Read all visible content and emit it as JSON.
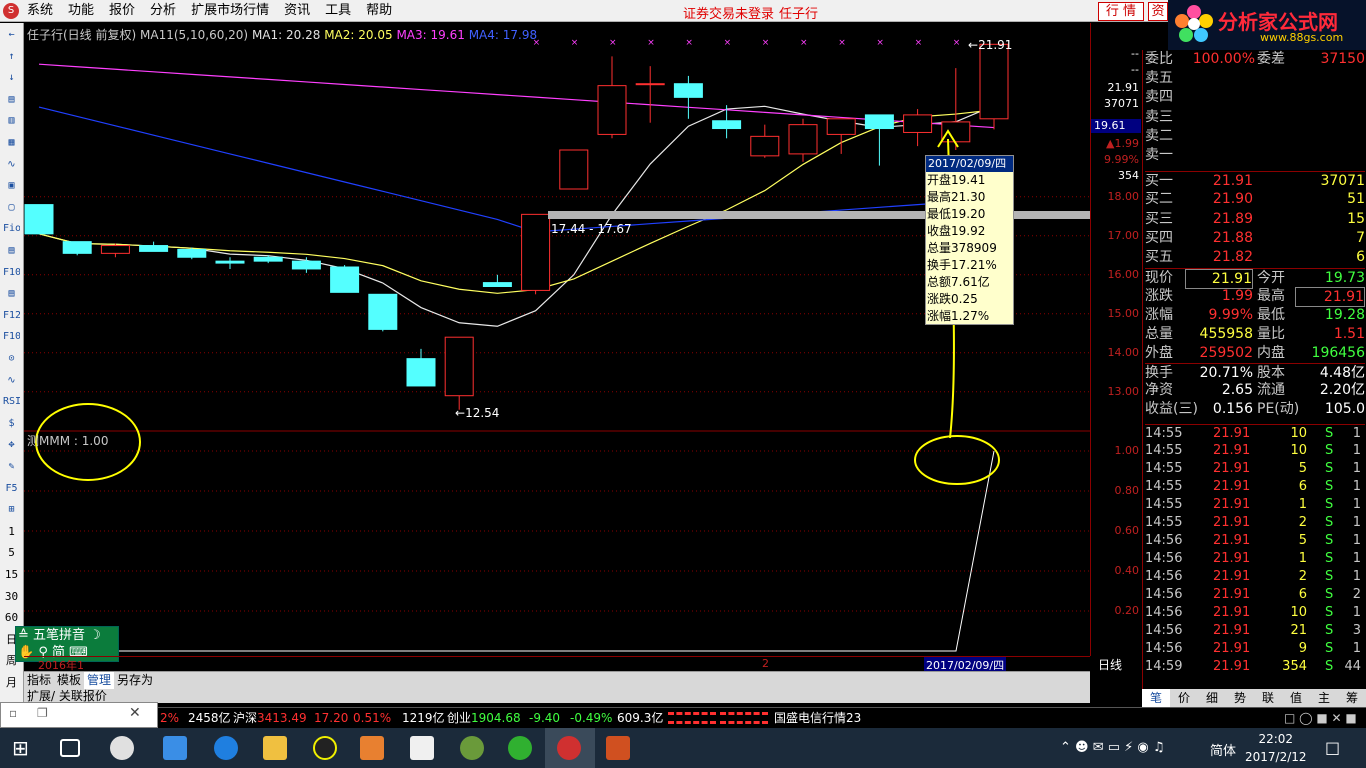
{
  "menu": {
    "items": [
      "系统",
      "功能",
      "报价",
      "分析",
      "扩展市场行情",
      "资讯",
      "工具",
      "帮助"
    ],
    "status": "证券交易未登录",
    "stock_name": "任子行",
    "quote_btn": "行 情",
    "trade_btn": "资"
  },
  "ad": {
    "title": "分析家公式网",
    "url": "www.88gs.com"
  },
  "left_toolbar": [
    "←",
    "↑",
    "↓",
    "▤",
    "▥",
    "▦",
    "∿",
    "▣",
    "▢",
    "Fio",
    "▤",
    "F10",
    "▤",
    "F12",
    "F10",
    "⊙",
    "∿",
    "RSI",
    "$",
    "✥",
    "✎",
    "F5",
    "⊞",
    "1",
    "5",
    "15",
    "30",
    "60",
    "日",
    "周",
    "月"
  ],
  "price_title": {
    "stock": "任子行(日线 前复权)",
    "formula": "MA11(5,10,60,20)",
    "ma1_label": "MA1: 20.28",
    "ma2_label": "MA2: 20.05",
    "ma3_label": "MA3: 19.61",
    "ma4_label": "MA4: 17.98"
  },
  "indicator_title": "测MMM : 1.00",
  "high_label": "21.91",
  "low_label": "12.54",
  "range_label": "17.44 - 17.67",
  "tooltip": {
    "date": "2017/02/09/四",
    "rows": [
      {
        "k": "开盘",
        "v": "19.41"
      },
      {
        "k": "最高",
        "v": "21.30"
      },
      {
        "k": "最低",
        "v": "19.20"
      },
      {
        "k": "收盘",
        "v": "19.92"
      },
      {
        "k": "总量",
        "v": "378909"
      },
      {
        "k": "换手",
        "v": "17.21%"
      },
      {
        "k": "总额",
        "v": "7.61亿"
      },
      {
        "k": "涨跌",
        "v": "0.25"
      },
      {
        "k": "涨幅",
        "v": "1.27%"
      }
    ]
  },
  "right_scale": {
    "top": [
      "--",
      "--",
      "21.91",
      "37071"
    ],
    "ma_badge": "19.61",
    "change": "▲1.99",
    "pct": "9.99%",
    "vol": "354",
    "ticks": [
      "18.00",
      "17.00",
      "16.00",
      "15.00",
      "14.00",
      "13.00"
    ],
    "ind_ticks": [
      "1.00",
      "0.80",
      "0.60",
      "0.40",
      "0.20"
    ]
  },
  "order_book": {
    "weibi_label": "委比",
    "weibi": "100.00%",
    "weicha_label": "委差",
    "weicha": "37150",
    "sells": [
      {
        "k": "卖五",
        "p": "",
        "v": ""
      },
      {
        "k": "卖四",
        "p": "",
        "v": ""
      },
      {
        "k": "卖三",
        "p": "",
        "v": ""
      },
      {
        "k": "卖二",
        "p": "",
        "v": ""
      },
      {
        "k": "卖一",
        "p": "",
        "v": ""
      }
    ],
    "buys": [
      {
        "k": "买一",
        "p": "21.91",
        "v": "37071"
      },
      {
        "k": "买二",
        "p": "21.90",
        "v": "51"
      },
      {
        "k": "买三",
        "p": "21.89",
        "v": "15"
      },
      {
        "k": "买四",
        "p": "21.88",
        "v": "7"
      },
      {
        "k": "买五",
        "p": "21.82",
        "v": "6"
      }
    ]
  },
  "quote": [
    {
      "k1": "现价",
      "v1": "21.91",
      "k2": "今开",
      "v2": "19.73"
    },
    {
      "k1": "涨跌",
      "v1": "1.99",
      "k2": "最高",
      "v2": "21.91"
    },
    {
      "k1": "涨幅",
      "v1": "9.99%",
      "k2": "最低",
      "v2": "19.28"
    },
    {
      "k1": "总量",
      "v1": "455958",
      "k2": "量比",
      "v2": "1.51"
    },
    {
      "k1": "外盘",
      "v1": "259502",
      "k2": "内盘",
      "v2": "196456"
    },
    {
      "k1": "换手",
      "v1": "20.71%",
      "k2": "股本",
      "v2": "4.48亿"
    },
    {
      "k1": "净资",
      "v1": "2.65",
      "k2": "流通",
      "v2": "2.20亿"
    },
    {
      "k1": "收益(三)",
      "v1": "0.156",
      "k2": "PE(动)",
      "v2": "105.0"
    }
  ],
  "ticks": [
    {
      "t": "14:55",
      "p": "21.91",
      "v": "10",
      "s": "S",
      "n": "1"
    },
    {
      "t": "14:55",
      "p": "21.91",
      "v": "10",
      "s": "S",
      "n": "1"
    },
    {
      "t": "14:55",
      "p": "21.91",
      "v": "5",
      "s": "S",
      "n": "1"
    },
    {
      "t": "14:55",
      "p": "21.91",
      "v": "6",
      "s": "S",
      "n": "1"
    },
    {
      "t": "14:55",
      "p": "21.91",
      "v": "1",
      "s": "S",
      "n": "1"
    },
    {
      "t": "14:55",
      "p": "21.91",
      "v": "2",
      "s": "S",
      "n": "1"
    },
    {
      "t": "14:56",
      "p": "21.91",
      "v": "5",
      "s": "S",
      "n": "1"
    },
    {
      "t": "14:56",
      "p": "21.91",
      "v": "1",
      "s": "S",
      "n": "1"
    },
    {
      "t": "14:56",
      "p": "21.91",
      "v": "2",
      "s": "S",
      "n": "1"
    },
    {
      "t": "14:56",
      "p": "21.91",
      "v": "6",
      "s": "S",
      "n": "2"
    },
    {
      "t": "14:56",
      "p": "21.91",
      "v": "10",
      "s": "S",
      "n": "1"
    },
    {
      "t": "14:56",
      "p": "21.91",
      "v": "21",
      "s": "S",
      "n": "3"
    },
    {
      "t": "14:56",
      "p": "21.91",
      "v": "9",
      "s": "S",
      "n": "1"
    },
    {
      "t": "14:59",
      "p": "21.91",
      "v": "354",
      "s": "S",
      "n": "44"
    }
  ],
  "ime": {
    "name": "五笔拼音",
    "mode": "简"
  },
  "bottom_tabs": [
    "指标",
    "模板",
    "管理",
    "另存为"
  ],
  "ext_bar": "扩展/  关联报价",
  "date_bar": {
    "left": "2016年1",
    "mid": "2",
    "cursor": "2017/02/09/四",
    "period": "日线"
  },
  "rp_tabs": [
    "笔",
    "价",
    "细",
    "势",
    "联",
    "值",
    "主",
    "筹"
  ],
  "statusbar": {
    "a": "2%",
    "b": "2458亿",
    "hs_label": "沪深",
    "hs_val": "3413.49",
    "hs_chg": "17.20",
    "hs_pct": "0.51%",
    "hs_amt": "1219亿",
    "cy_label": "创业",
    "cy_val": "1904.68",
    "cy_chg": "-9.40",
    "cy_pct": "-0.49%",
    "cy_amt": "609.3亿",
    "news": "国盛电信行情23"
  },
  "clock": {
    "time": "22:02",
    "date": "2017/2/12",
    "ime": "简体"
  },
  "chart_data": {
    "type": "candlestick",
    "series": [
      {
        "o": 17.8,
        "h": 17.8,
        "c": 17.05,
        "l": 17.05
      },
      {
        "o": 16.85,
        "h": 16.85,
        "c": 16.55,
        "l": 16.5
      },
      {
        "o": 16.55,
        "h": 16.8,
        "c": 16.75,
        "l": 16.45
      },
      {
        "o": 16.75,
        "h": 16.85,
        "c": 16.6,
        "l": 16.6
      },
      {
        "o": 16.65,
        "h": 16.7,
        "c": 16.45,
        "l": 16.4
      },
      {
        "o": 16.35,
        "h": 16.45,
        "c": 16.3,
        "l": 16.15
      },
      {
        "o": 16.45,
        "h": 16.5,
        "c": 16.35,
        "l": 16.3
      },
      {
        "o": 16.35,
        "h": 16.45,
        "c": 16.15,
        "l": 16.05
      },
      {
        "o": 16.2,
        "h": 16.25,
        "c": 15.55,
        "l": 15.55
      },
      {
        "o": 15.5,
        "h": 15.5,
        "c": 14.6,
        "l": 14.55
      },
      {
        "o": 13.85,
        "h": 14.1,
        "c": 13.15,
        "l": 13.15
      },
      {
        "o": 12.9,
        "h": 14.4,
        "c": 14.4,
        "l": 12.54
      },
      {
        "o": 15.8,
        "h": 16.0,
        "c": 15.7,
        "l": 15.7
      },
      {
        "o": 15.6,
        "h": 17.55,
        "c": 17.55,
        "l": 15.5
      },
      {
        "o": 18.2,
        "h": 19.2,
        "c": 19.2,
        "l": 18.2
      },
      {
        "o": 19.6,
        "h": 21.6,
        "c": 20.85,
        "l": 19.5
      },
      {
        "o": 20.9,
        "h": 21.35,
        "c": 20.9,
        "l": 19.9
      },
      {
        "o": 20.9,
        "h": 21.1,
        "c": 20.55,
        "l": 20.0
      },
      {
        "o": 19.95,
        "h": 20.35,
        "c": 19.75,
        "l": 19.5
      },
      {
        "o": 19.05,
        "h": 19.85,
        "c": 19.55,
        "l": 19.0
      },
      {
        "o": 19.1,
        "h": 20.0,
        "c": 19.85,
        "l": 18.9
      },
      {
        "o": 19.6,
        "h": 20.0,
        "c": 20.0,
        "l": 19.1
      },
      {
        "o": 20.1,
        "h": 20.1,
        "c": 19.75,
        "l": 18.8
      },
      {
        "o": 19.65,
        "h": 20.25,
        "c": 20.1,
        "l": 19.3
      },
      {
        "o": 19.41,
        "h": 21.3,
        "c": 19.92,
        "l": 19.2
      },
      {
        "o": 20.0,
        "h": 21.91,
        "c": 21.91,
        "l": 19.73
      }
    ],
    "ylim": [
      12.2,
      22.2
    ]
  }
}
